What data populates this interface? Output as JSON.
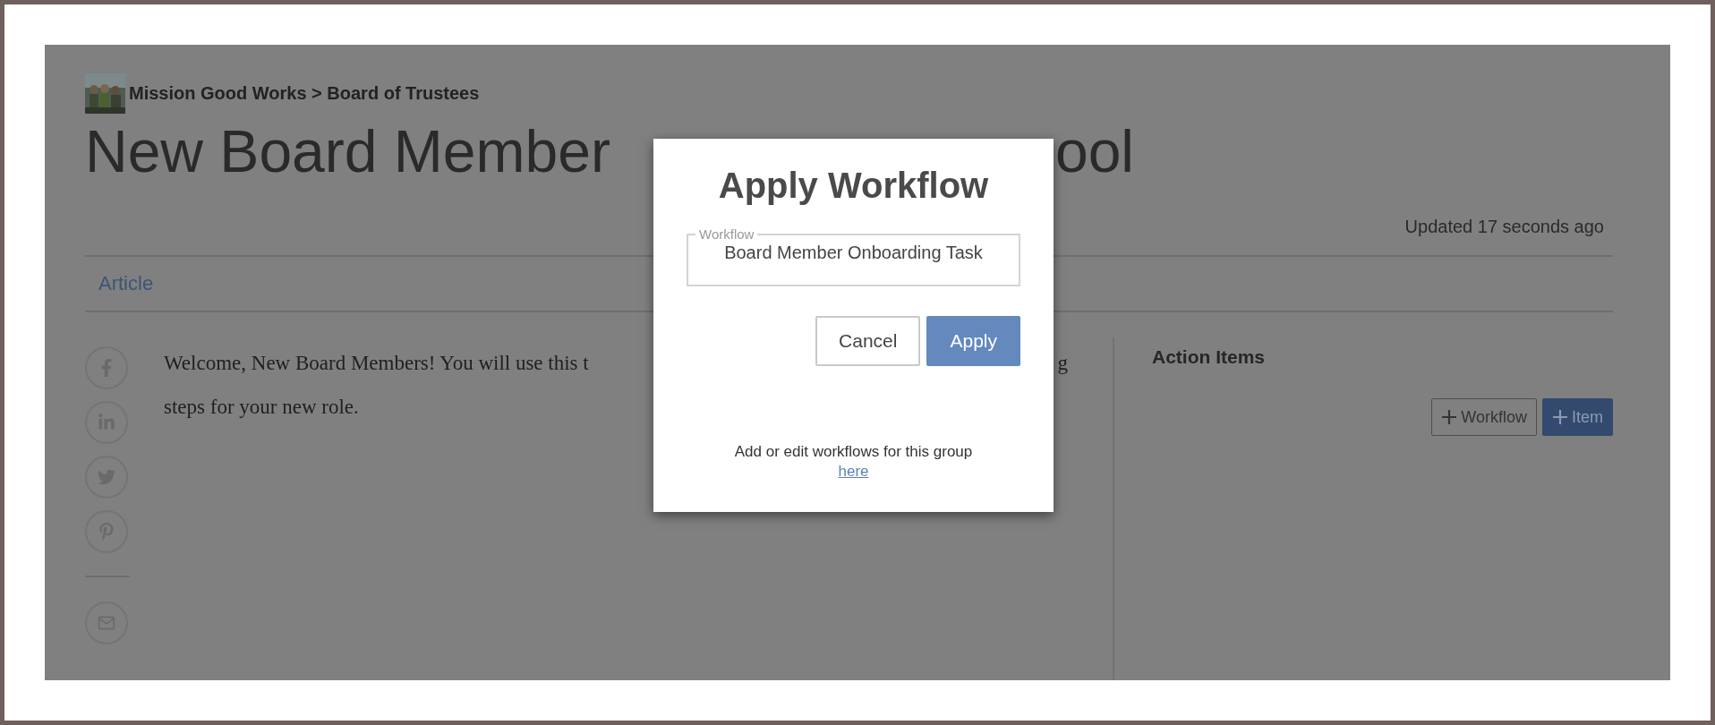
{
  "breadcrumb": {
    "text": "Mission Good Works > Board of Trustees"
  },
  "title": {
    "visible_parts": [
      "New Board Member",
      "ool"
    ]
  },
  "updated": "Updated 17 seconds ago",
  "tabs": [
    {
      "label": "Article",
      "selected": true
    }
  ],
  "share_buttons": [
    {
      "kind": "facebook"
    },
    {
      "kind": "linkedin"
    },
    {
      "kind": "twitter"
    },
    {
      "kind": "pinterest"
    },
    {
      "kind": "email"
    }
  ],
  "article": {
    "line_1_parts": [
      "Welcome, New Board Members! You will use this t",
      "g"
    ],
    "line_2": "steps for your new role."
  },
  "action_items": {
    "title": "Action Items",
    "buttons": [
      {
        "label": "Workflow",
        "kind": "outline"
      },
      {
        "label": "Item",
        "kind": "primary"
      }
    ]
  },
  "dialog": {
    "title": "Apply Workflow",
    "field": {
      "label": "Workflow",
      "value": "Board Member Onboarding Task"
    },
    "buttons": [
      {
        "label": "Cancel",
        "kind": "secondary"
      },
      {
        "label": "Apply",
        "kind": "primary"
      }
    ],
    "footer": {
      "text": "Add or edit workflows for this group",
      "link": "here"
    }
  }
}
